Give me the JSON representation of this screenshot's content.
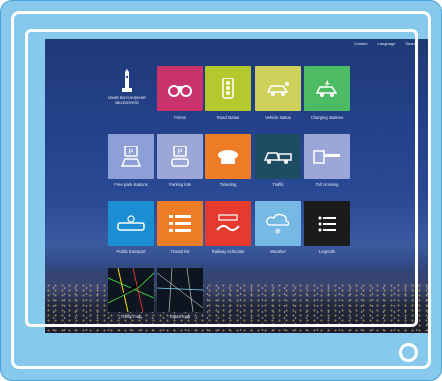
{
  "header": {
    "links": [
      "Contact",
      "Language",
      "Search"
    ]
  },
  "logo": {
    "text": "İZMİR BÜYÜKŞEHİR BELEDİYESİ"
  },
  "tiles": [
    {
      "label": "Points",
      "color": "#c9336a",
      "icon": "binoculars-icon"
    },
    {
      "label": "Road status",
      "color": "#b4c92e",
      "icon": "traffic-light-icon"
    },
    {
      "label": "Vehicle status",
      "color": "#cfd05a",
      "icon": "car-location-icon"
    },
    {
      "label": "Charging stations",
      "color": "#4dbb63",
      "icon": "ev-car-icon"
    },
    {
      "label": "Free park stations",
      "color": "#8c9fd6",
      "icon": "parking-icon"
    },
    {
      "label": "Parking lots",
      "color": "#9aa7d8",
      "icon": "parking-car-icon"
    },
    {
      "label": "Ticketing",
      "color": "#ef7c26",
      "icon": "ticket-car-icon"
    },
    {
      "label": "Traffic",
      "color": "#1e4d63",
      "icon": "tow-truck-icon"
    },
    {
      "label": "Toll crossing",
      "color": "#9aa7d8",
      "icon": "toll-barrier-icon"
    },
    {
      "label": "Public transport",
      "color": "#1c8ed4",
      "icon": "tram-icon"
    },
    {
      "label": "Transit list",
      "color": "#ef7c26",
      "icon": "list-icon"
    },
    {
      "label": "Railway schedule",
      "color": "#e63a2e",
      "icon": "train-map-icon"
    },
    {
      "label": "Weather",
      "color": "#76b9e4",
      "icon": "snow-cloud-icon"
    },
    {
      "label": "Legends",
      "color": "#1b1b1b",
      "icon": "menu-list-icon"
    }
  ],
  "maps": [
    {
      "label": "Traffic map"
    },
    {
      "label": "Route map"
    }
  ]
}
